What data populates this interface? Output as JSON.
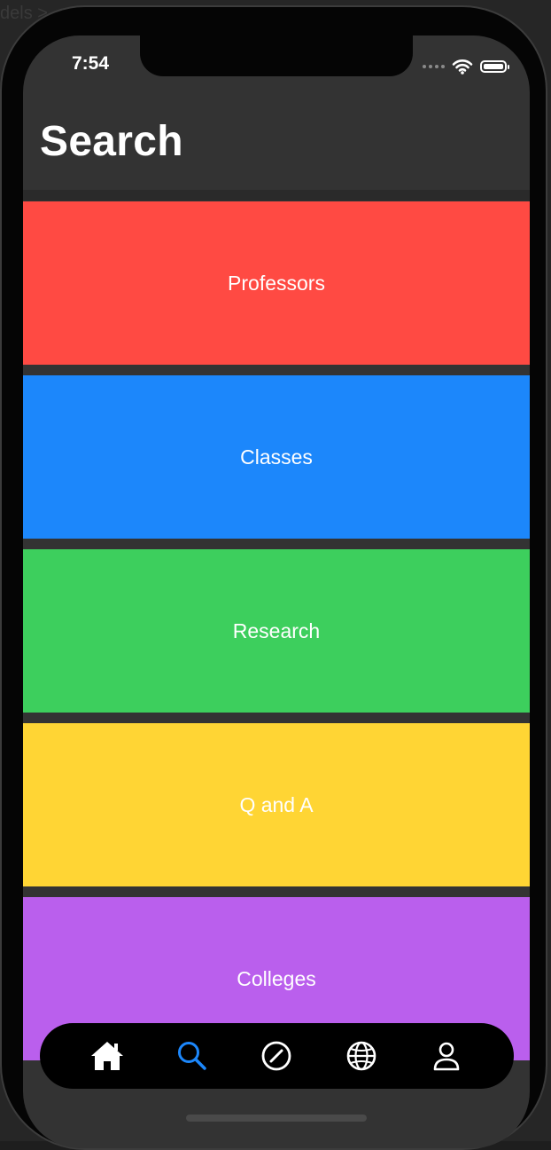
{
  "status_bar": {
    "time": "7:54"
  },
  "header": {
    "title": "Search"
  },
  "categories": [
    {
      "label": "Professors",
      "color": "#FF4A43"
    },
    {
      "label": "Classes",
      "color": "#1C87FB"
    },
    {
      "label": "Research",
      "color": "#3DCF5D"
    },
    {
      "label": "Q and A",
      "color": "#FFD534"
    },
    {
      "label": "Colleges",
      "color": "#BA5FED"
    }
  ],
  "tab_bar": {
    "active_color": "#1C87FB",
    "inactive_color": "#FFFFFF",
    "tabs": [
      {
        "icon": "home-icon",
        "active": false
      },
      {
        "icon": "search-icon",
        "active": true
      },
      {
        "icon": "compass-icon",
        "active": false
      },
      {
        "icon": "globe-icon",
        "active": false
      },
      {
        "icon": "profile-icon",
        "active": false
      }
    ]
  },
  "backdrop_text": "dels >"
}
